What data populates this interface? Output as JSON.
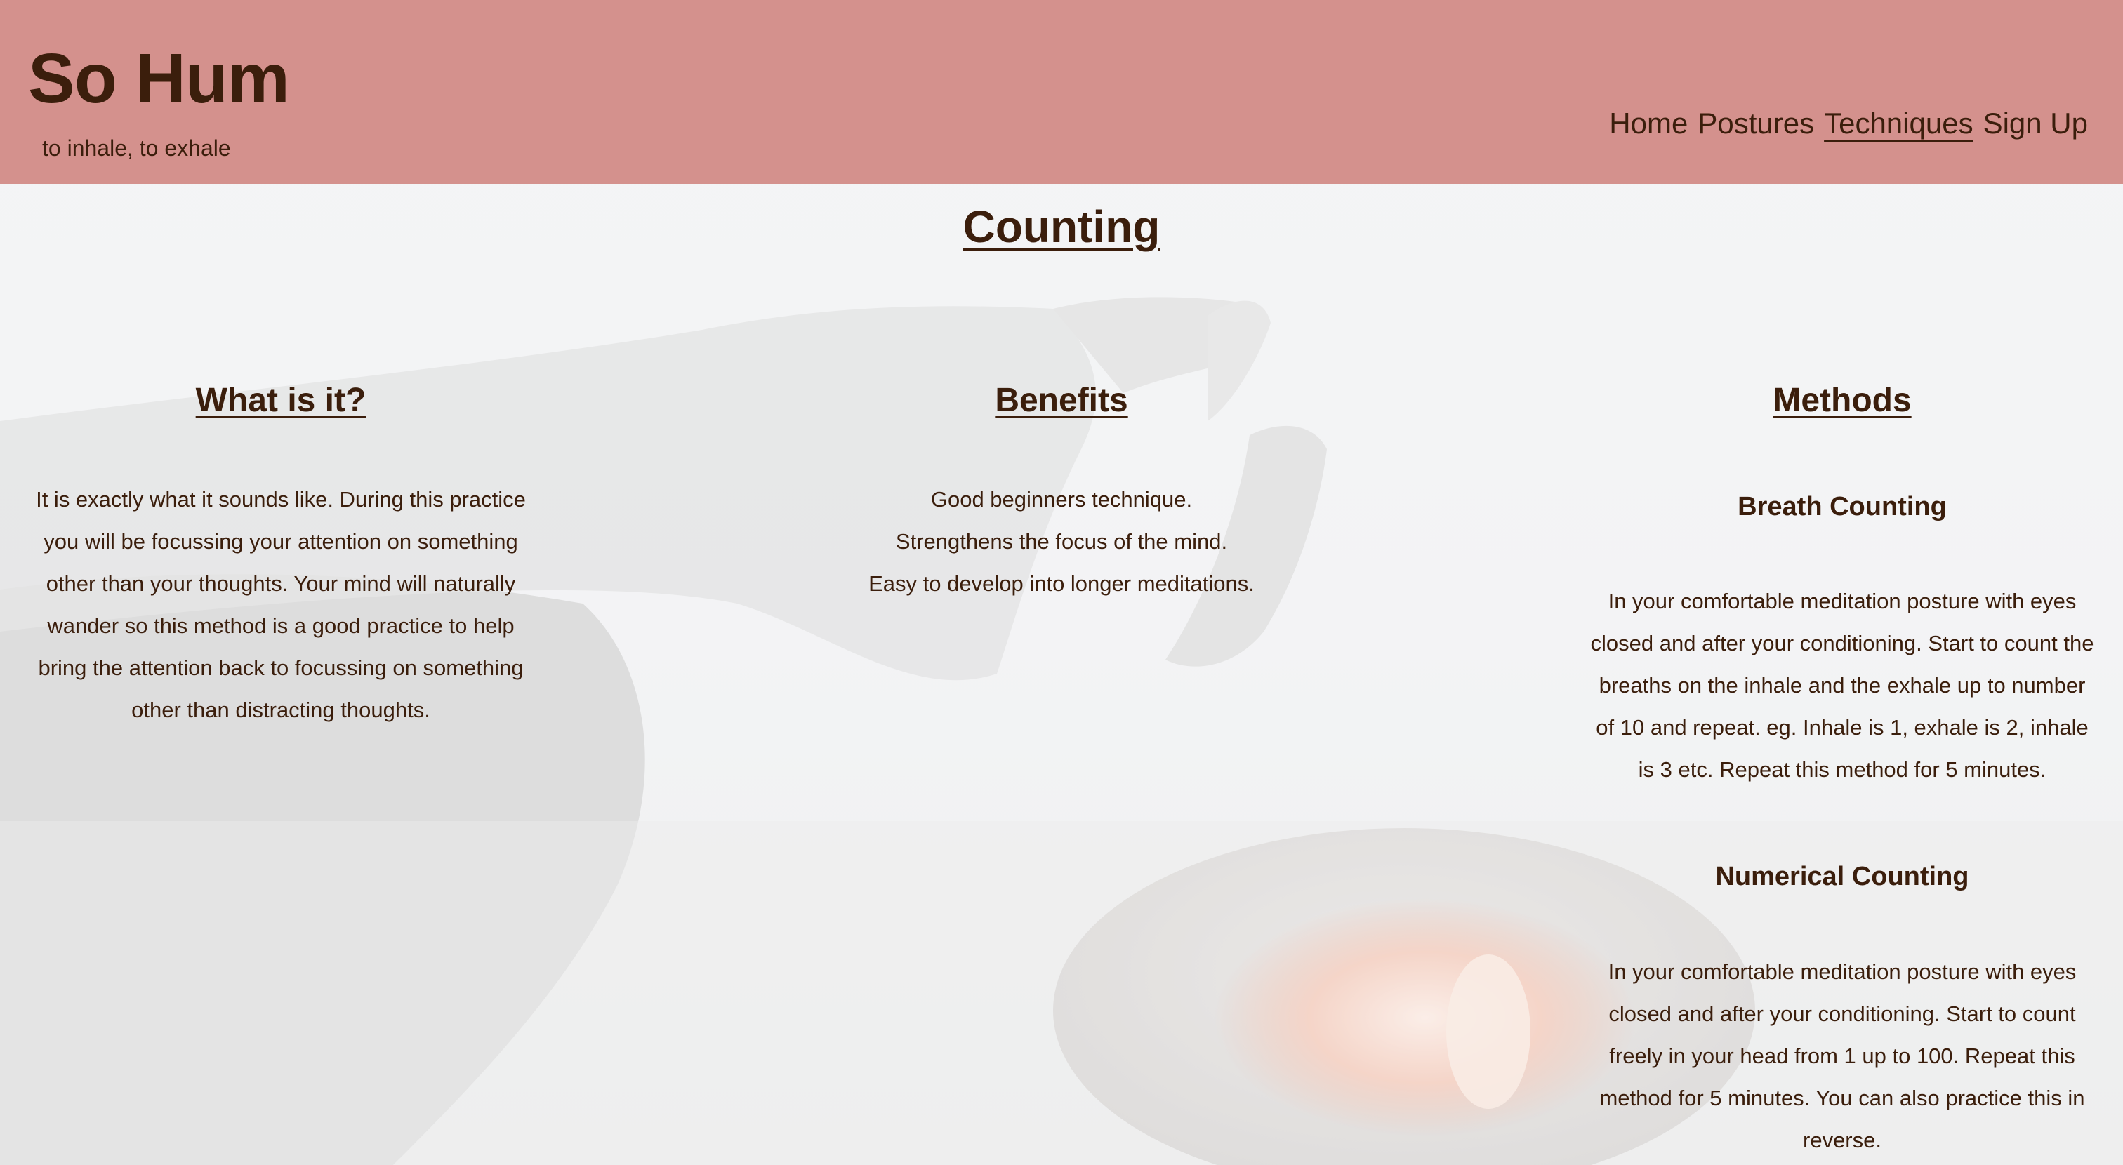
{
  "header": {
    "site_title": "So Hum",
    "tagline": "to inhale, to exhale",
    "nav": [
      {
        "label": "Home",
        "active": false
      },
      {
        "label": "Postures",
        "active": false
      },
      {
        "label": "Techniques",
        "active": true
      },
      {
        "label": "Sign Up",
        "active": false
      }
    ],
    "background_color": "#d4918d",
    "text_color": "#3b1e0c"
  },
  "main": {
    "page_title": "Counting",
    "what_is_it": {
      "heading": "What is it?",
      "lines": [
        "It is exactly what it sounds like. During this practice",
        "you will be focussing your attention on something",
        "other than your thoughts. Your mind will naturally",
        "wander so this method is a good practice to help",
        "bring the attention back to focussing on something",
        "other than distracting thoughts."
      ]
    },
    "benefits": {
      "heading": "Benefits",
      "items": [
        "Good beginners technique.",
        "Strengthens the focus of the mind.",
        "Easy to develop into longer meditations."
      ]
    },
    "methods": {
      "heading": "Methods",
      "breath_counting": {
        "title": "Breath Counting",
        "lines": [
          "In your comfortable meditation posture with eyes",
          "closed and after your conditioning. Start to count the",
          "breaths on the inhale and the exhale up to number",
          "of 10 and repeat. eg. Inhale is 1, exhale is 2, inhale",
          "is 3 etc. Repeat this method for 5 minutes."
        ]
      },
      "numerical_counting": {
        "title": "Numerical Counting",
        "lines": [
          "In your comfortable meditation posture with eyes",
          "closed and after your conditioning. Start to count",
          "freely in your head from 1 up to 100. Repeat this",
          "method for 5 minutes. You can also practice this in",
          "reverse."
        ]
      }
    }
  }
}
